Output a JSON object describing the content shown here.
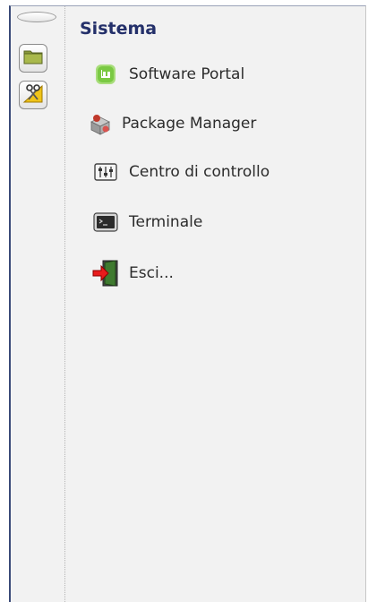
{
  "menu": {
    "section_title": "Sistema",
    "items": [
      {
        "label": "Software Portal",
        "icon": "mint-software-icon"
      },
      {
        "label": "Package Manager",
        "icon": "package-manager-icon"
      },
      {
        "label": "Centro di controllo",
        "icon": "control-center-icon"
      },
      {
        "label": "Terminale",
        "icon": "terminal-icon"
      },
      {
        "label": "Esci...",
        "icon": "logout-icon"
      }
    ]
  },
  "sidebar": {
    "buttons": [
      {
        "icon": "folder-icon"
      },
      {
        "icon": "tools-icon"
      }
    ]
  },
  "colors": {
    "title": "#24306a",
    "panel_bg": "#f2f2f2",
    "mint_green": "#7ac943",
    "logout_red": "#e81c1c"
  }
}
